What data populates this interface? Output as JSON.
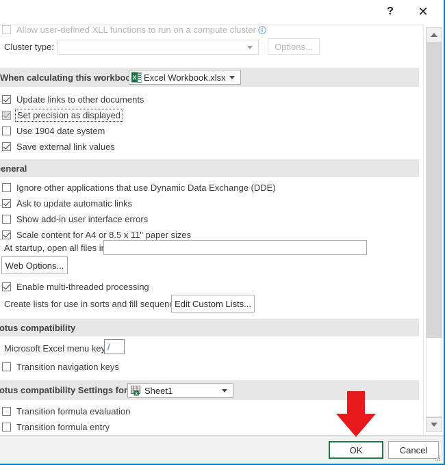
{
  "window": {
    "titlebar": {
      "help_label": "?",
      "close_label": "✕"
    }
  },
  "content": {
    "clipped_top_checkbox": {
      "label": "Allow user-defined XLL functions to run on a compute cluster",
      "checked": false,
      "enabled": false,
      "info_icon": "info-icon"
    },
    "cluster_type": {
      "label": "Cluster type:",
      "value": "",
      "options_button": "Options..."
    },
    "when_calculating": {
      "label": "When calculating this workbook:",
      "value": "Excel Workbook.xlsx",
      "icon": "excel-workbook-icon"
    },
    "calculation_checkboxes": [
      {
        "label": "Update links to other documents",
        "checked": true,
        "state": "normal"
      },
      {
        "label": "Set precision as displayed",
        "checked": true,
        "state": "focused-gray"
      },
      {
        "label": "Use 1904 date system",
        "checked": false,
        "state": "normal"
      },
      {
        "label": "Save external link values",
        "checked": true,
        "state": "normal"
      }
    ],
    "general": {
      "section_title": "General",
      "checkboxes": [
        {
          "label": "Ignore other applications that use Dynamic Data Exchange (DDE)",
          "checked": false
        },
        {
          "label": "Ask to update automatic links",
          "checked": true
        },
        {
          "label": "Show add-in user interface errors",
          "checked": false
        },
        {
          "label": "Scale content for A4 or 8.5 x 11\" paper sizes",
          "checked": true
        }
      ],
      "startup": {
        "label": "At startup, open all files in:",
        "value": ""
      },
      "web_options_button": "Web Options...",
      "multithread": {
        "label": "Enable multi-threaded processing",
        "checked": true
      },
      "custom_lists": {
        "label": "Create lists for use in sorts and fill sequences:",
        "button": "Edit Custom Lists..."
      }
    },
    "lotus": {
      "section_title": "Lotus compatibility",
      "menu_key": {
        "label": "Microsoft Excel menu key:",
        "value": "/"
      },
      "transition_nav": {
        "label": "Transition navigation keys",
        "checked": false
      },
      "settings_for": {
        "label": "Lotus compatibility Settings for:",
        "value": "Sheet1",
        "icon": "worksheet-icon"
      },
      "transition_checkboxes": [
        {
          "label": "Transition formula evaluation",
          "checked": false
        },
        {
          "label": "Transition formula entry",
          "checked": false
        }
      ]
    }
  },
  "footer": {
    "ok_label": "OK",
    "cancel_label": "Cancel"
  },
  "annotation": {
    "arrow": "red-down-arrow",
    "points_to": "OK"
  },
  "colors": {
    "accent_green": "#1f7a45",
    "annotation_red": "#e8191b",
    "section_bar": "#e6e6e6",
    "window_border_blue": "#0a7ac0",
    "excel_green": "#1e7145"
  },
  "scrollbar": {
    "up_arrow": "scroll-up-arrow",
    "down_arrow": "scroll-down-arrow"
  }
}
